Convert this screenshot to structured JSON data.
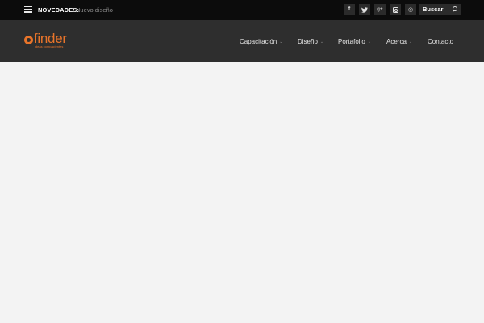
{
  "topbar": {
    "news_label": "NOVEDADES:",
    "news_item": "Nuevo diseño",
    "social": [
      {
        "icon": "facebook-icon",
        "glyph": "f"
      },
      {
        "icon": "twitter-icon",
        "glyph": "🐦"
      },
      {
        "icon": "google-plus-icon",
        "glyph": "g+"
      },
      {
        "icon": "instagram-icon"
      },
      {
        "icon": "dribbble-icon",
        "glyph": "◎"
      }
    ],
    "search_label": "Buscar"
  },
  "header": {
    "logo_text": "finder",
    "logo_tagline": "ideas compacientes",
    "brand_color": "#e8742a",
    "nav": [
      {
        "label": "Capacitación",
        "has_dropdown": true
      },
      {
        "label": "Diseño",
        "has_dropdown": true
      },
      {
        "label": "Portafolio",
        "has_dropdown": true
      },
      {
        "label": "Acerca",
        "has_dropdown": true
      },
      {
        "label": "Contacto",
        "has_dropdown": false
      }
    ]
  },
  "icons": {
    "caret": "⌄"
  },
  "colors": {
    "topbar_bg": "#0c0c0c",
    "header_bg": "#2e2e2e",
    "content_bg": "#f3f3f3",
    "accent": "#e8742a"
  }
}
